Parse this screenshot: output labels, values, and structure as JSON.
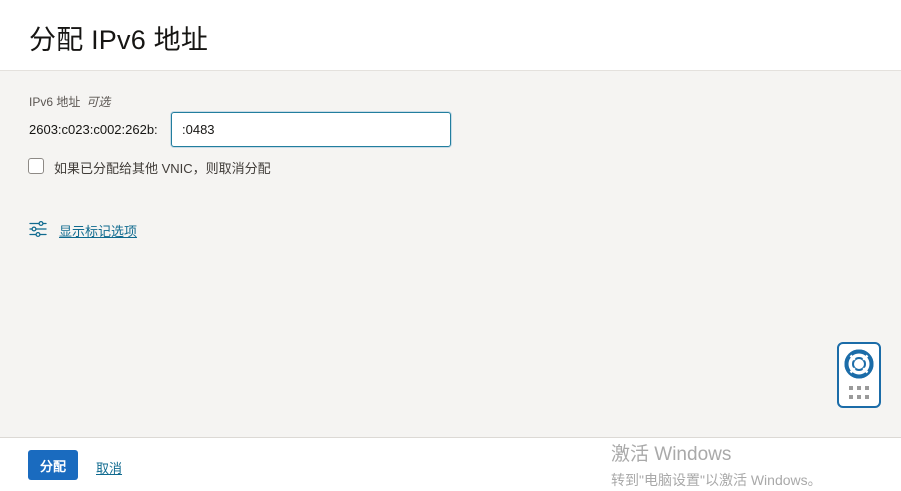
{
  "header": {
    "title": "分配 IPv6 地址"
  },
  "form": {
    "field_label": "IPv6 地址",
    "optional_label": "可选",
    "prefix": "2603:c023:c002:262b:",
    "input_value": ":0483",
    "checkbox_label": "如果已分配给其他 VNIC，则取消分配",
    "checkbox_checked": false
  },
  "tags": {
    "link_label": "显示标记选项",
    "icon": "sliders-icon"
  },
  "help_widget": {
    "icon": "lifebuoy-icon",
    "grip_icon": "grip-dots-icon"
  },
  "footer": {
    "assign_label": "分配",
    "cancel_label": "取消"
  },
  "watermark": {
    "title": "激活 Windows",
    "subtitle": "转到\"电脑设置\"以激活 Windows。"
  },
  "colors": {
    "primary": "#1a6bbf",
    "link": "#0f6a8f",
    "focus_border": "#227e9e",
    "help_border": "#1b6ca8"
  }
}
